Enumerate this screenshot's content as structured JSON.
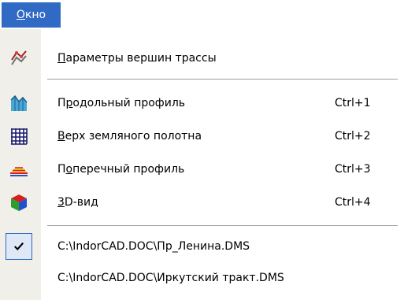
{
  "menu": {
    "title_accel": "О",
    "title_rest": "кно"
  },
  "items": [
    {
      "icon": "route-vertices-icon",
      "label_accel": "П",
      "label_rest": "араметры вершин трассы",
      "shortcut": ""
    },
    {
      "icon": "longitudinal-profile-icon",
      "label_before": "П",
      "label_accel": "р",
      "label_rest": "одольный профиль",
      "shortcut": "Ctrl+1"
    },
    {
      "icon": "subgrade-top-icon",
      "label_accel": "В",
      "label_rest": "ерх земляного полотна",
      "shortcut": "Ctrl+2"
    },
    {
      "icon": "cross-section-icon",
      "label_before": "П",
      "label_accel": "о",
      "label_rest": "перечный профиль",
      "shortcut": "Ctrl+3"
    },
    {
      "icon": "3d-view-icon",
      "label_accel": "3",
      "label_rest": "D-вид",
      "shortcut": "Ctrl+4"
    }
  ],
  "documents": [
    {
      "icon": "checkmark-icon",
      "checked": true,
      "path": "C:\\IndorCAD.DOC\\Пр_Ленина.DMS"
    },
    {
      "icon": "",
      "checked": false,
      "path": "C:\\IndorCAD.DOC\\Иркутский тракт.DMS"
    }
  ],
  "colors": {
    "menu_highlight": "#316ac5",
    "gutter": "#f0efea"
  }
}
